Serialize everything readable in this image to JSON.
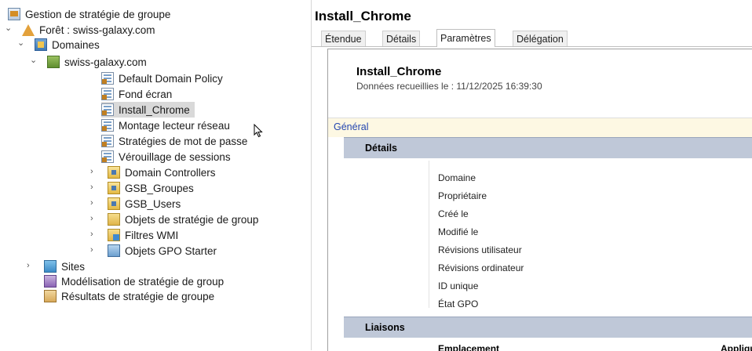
{
  "tree": {
    "root": "Gestion de stratégie de groupe",
    "forest": "Forêt : swiss-galaxy.com",
    "domains": "Domaines",
    "domain": "swiss-galaxy.com",
    "gpos": [
      "Default Domain Policy",
      "Fond écran",
      "Install_Chrome",
      "Montage lecteur réseau",
      "Stratégies de mot de passe",
      "Vérouillage de sessions"
    ],
    "ous": [
      "Domain Controllers",
      "GSB_Groupes",
      "GSB_Users"
    ],
    "gpo_objects": "Objets de stratégie de group",
    "wmi_filters": "Filtres WMI",
    "starter_gpos": "Objets GPO Starter",
    "sites": "Sites",
    "modeling": "Modélisation de stratégie de group",
    "results": "Résultats de stratégie de groupe",
    "selected": "Install_Chrome"
  },
  "pane": {
    "title": "Install_Chrome",
    "tabs": [
      "Étendue",
      "Détails",
      "Paramètres",
      "Délégation"
    ],
    "active_tab": "Paramètres"
  },
  "report": {
    "title": "Install_Chrome",
    "collected": "Données recueillies le : 11/12/2025 16:39:30",
    "general": "Général",
    "details_header": "Détails",
    "details": [
      "Domaine",
      "Propriétaire",
      "Créé le",
      "Modifié le",
      "Révisions utilisateur",
      "Révisions ordinateur",
      "ID unique",
      "État GPO"
    ],
    "links_header": "Liaisons",
    "links_col1": "Emplacement",
    "links_col2": "Appliqu"
  },
  "colors": {
    "selection": "#d9d9d9",
    "section_header": "#bfc8d8",
    "general_band": "#fdf8e3",
    "link_blue": "#2346b0"
  }
}
